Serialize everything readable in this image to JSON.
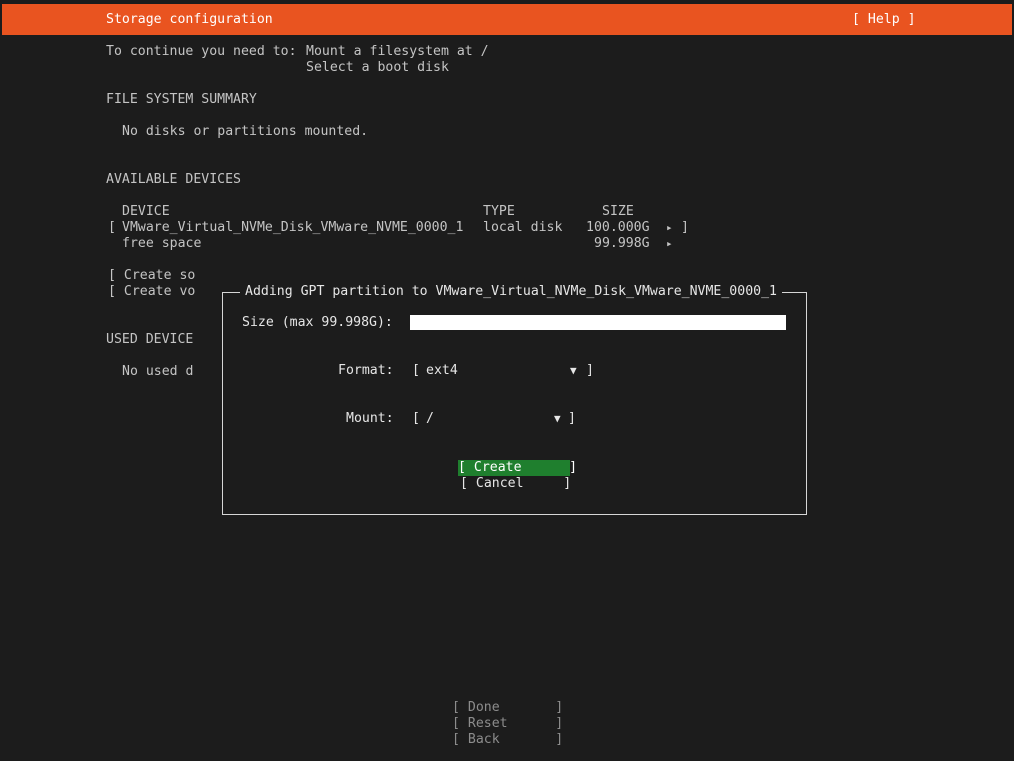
{
  "header": {
    "title": "Storage configuration",
    "help_button": "[ Help ]"
  },
  "requirements": {
    "prefix": "To continue you need to:",
    "items": [
      "Mount a filesystem at /",
      "Select a boot disk"
    ]
  },
  "file_system_summary": {
    "heading": "FILE SYSTEM SUMMARY",
    "empty_text": "No disks or partitions mounted."
  },
  "available_devices": {
    "heading": "AVAILABLE DEVICES",
    "columns": [
      "DEVICE",
      "TYPE",
      "SIZE"
    ],
    "rows": [
      {
        "open_bracket": "[",
        "device": "VMware_Virtual_NVMe_Disk_VMware_NVME_0000_1",
        "type": "local disk",
        "size": "100.000G",
        "arrow": "▸",
        "close_bracket": "]"
      },
      {
        "device": "free space",
        "size": "99.998G",
        "arrow": "▸"
      }
    ],
    "actions_partial": [
      "[ Create so",
      "[ Create vo"
    ]
  },
  "used_devices": {
    "heading_partial": "USED DEVICE",
    "empty_text_partial": "No used d"
  },
  "dialog": {
    "title": "Adding GPT partition to VMware_Virtual_NVMe_Disk_VMware_NVME_0000_1",
    "size_label": "Size (max 99.998G):",
    "size_value": "",
    "format_label": "Format:",
    "format_value": "ext4",
    "mount_label": "Mount:",
    "mount_value": "/",
    "open_bracket": "[",
    "close_bracket": "]",
    "dropdown_arrow": "▼",
    "create_button": "[ Create      ]",
    "cancel_button": "[ Cancel     ]"
  },
  "footer": {
    "done_button": "[ Done       ]",
    "reset_button": "[ Reset      ]",
    "back_button": "[ Back       ]"
  }
}
